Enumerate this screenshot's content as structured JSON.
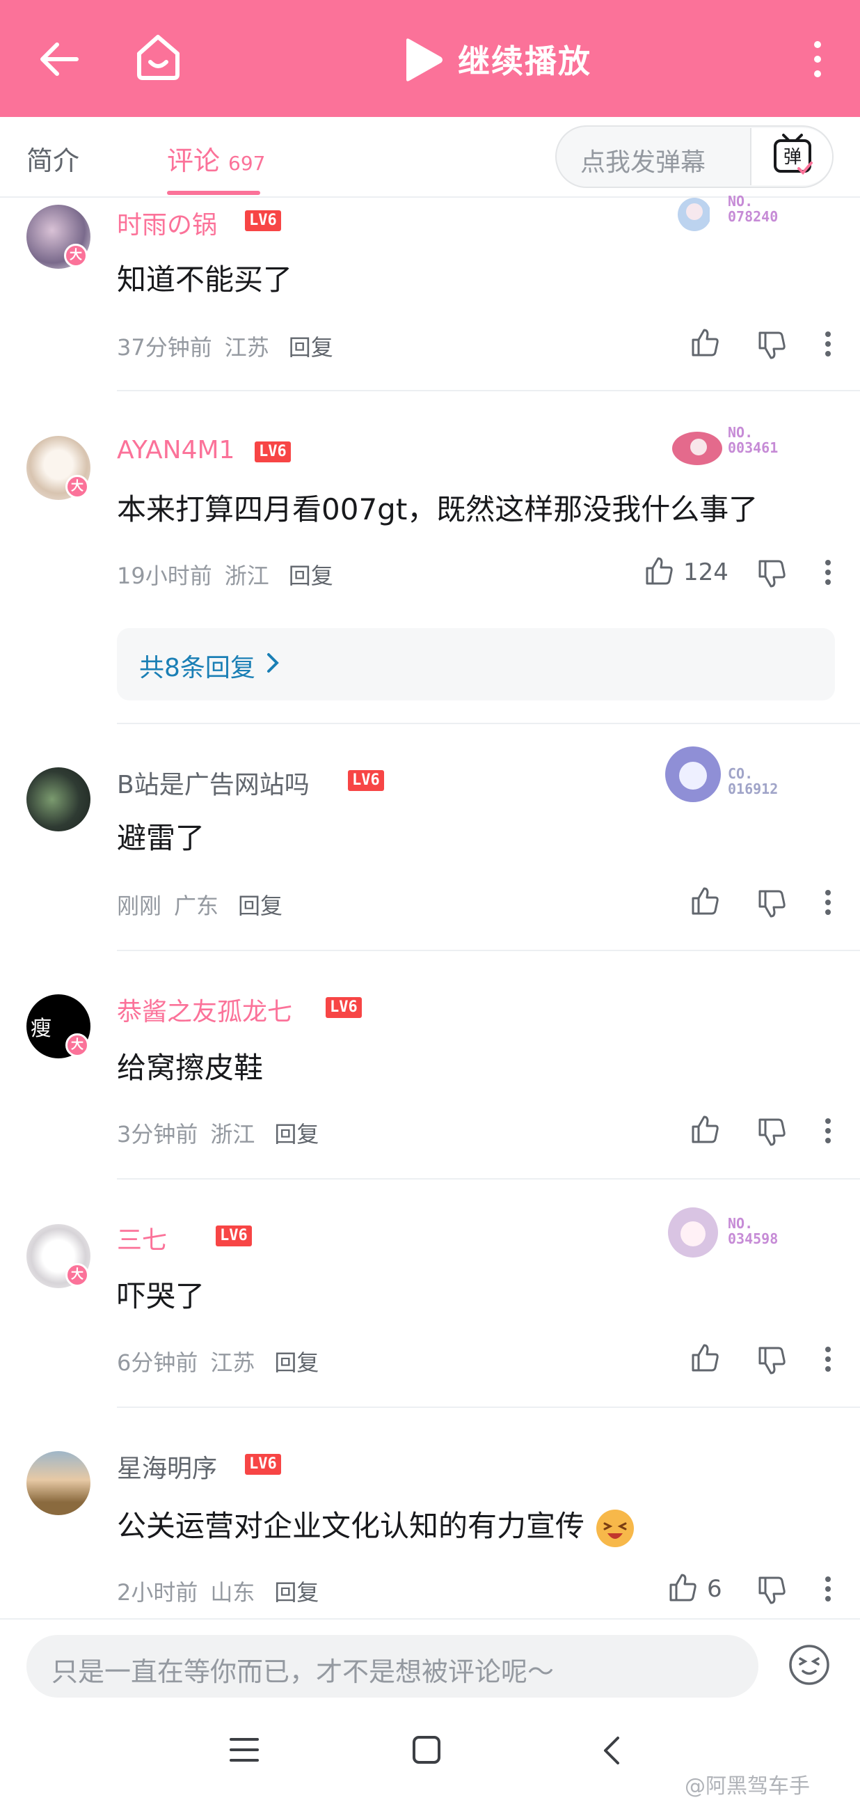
{
  "header": {
    "back_icon": "arrow-left-icon",
    "home_icon": "home-icon",
    "play_icon": "play-icon",
    "title": "继续播放",
    "more_icon": "more-vertical-icon",
    "bg_color": "#fb7299"
  },
  "tabs": {
    "intro": "简介",
    "comments": "评论",
    "comments_count": "697",
    "danmaku_placeholder": "点我发弹幕",
    "danmaku_icon": "danmaku-tv-icon",
    "accent_color": "#fb7299"
  },
  "comments": [
    {
      "username": "时雨の锅",
      "level": "LV6",
      "text": "知道不能买了",
      "time": "37分钟前",
      "location": "江苏",
      "reply_label": "回复",
      "likes": "",
      "fan_badge": "NO.\n078240"
    },
    {
      "username": "AYAN4M1",
      "level": "LV6",
      "text": "本来打算四月看007gt，既然这样那没我什么事了",
      "time": "19小时前",
      "location": "浙江",
      "reply_label": "回复",
      "likes": "124",
      "fan_badge": "NO.\n003461",
      "replies_label": "共8条回复"
    },
    {
      "username": "B站是广告网站吗",
      "level": "LV6",
      "text": "避雷了",
      "time": "刚刚",
      "location": "广东",
      "reply_label": "回复",
      "likes": "",
      "fan_badge": "CO.\n016912"
    },
    {
      "username": "恭酱之友孤龙七",
      "level": "LV6",
      "text": "给窝擦皮鞋",
      "time": "3分钟前",
      "location": "浙江",
      "reply_label": "回复",
      "likes": ""
    },
    {
      "username": "三七",
      "level": "LV6",
      "text": "吓哭了",
      "time": "6分钟前",
      "location": "江苏",
      "reply_label": "回复",
      "likes": "",
      "fan_badge": "NO.\n034598"
    },
    {
      "username": "星海明序",
      "level": "LV6",
      "text": "公关运营对企业文化认知的有力宣传",
      "time": "2小时前",
      "location": "山东",
      "reply_label": "回复",
      "likes": "6"
    }
  ],
  "big_member_badge": "大",
  "bottom_input": {
    "placeholder": "只是一直在等你而已，才不是想被评论呢～",
    "emoji_icon": "emoji-face-icon"
  },
  "nav": {
    "menu_icon": "menu-icon",
    "home_icon": "square-home-icon",
    "back_icon": "back-chevron-icon"
  },
  "watermark": "@阿黑驾车手"
}
